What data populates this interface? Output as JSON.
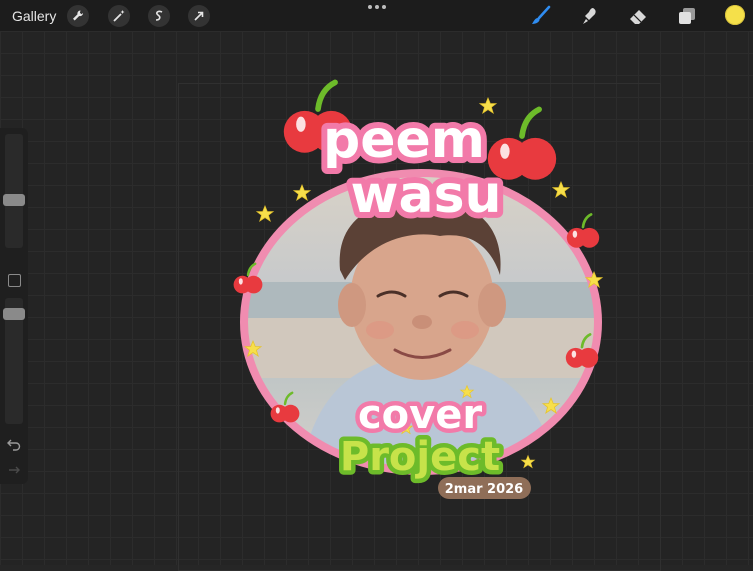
{
  "toolbar": {
    "gallery_label": "Gallery",
    "left_tools": [
      "wrench-icon",
      "magic-wand-icon",
      "selection-icon",
      "transform-arrow-icon"
    ],
    "right_tools": [
      "brush-icon",
      "smudge-icon",
      "eraser-icon",
      "layers-icon"
    ],
    "active_tool": "brush-icon",
    "current_color": "#f5e04a"
  },
  "sidebar": {
    "size_slider_level": 0.58,
    "opacity_slider_level": 0.58
  },
  "artwork": {
    "title_line1": "peem",
    "title_line2": "wasu",
    "banner_line1": "cover",
    "banner_line2": "Project",
    "date": "2mar 2026",
    "colors": {
      "frame_pink": "#f08cb0",
      "title_pink": "#f27aa9",
      "cherry_red": "#e83a3f",
      "leaf_green": "#6dbb2a",
      "project_green": "#c7e34a",
      "star_yellow": "#f7df4b",
      "date_brown": "#8f6e58"
    }
  }
}
